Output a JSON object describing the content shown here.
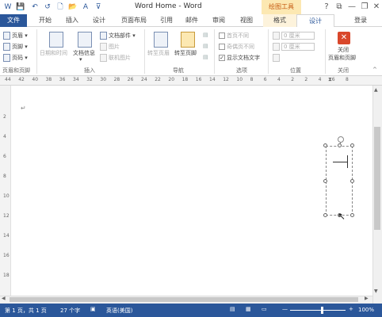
{
  "window": {
    "title": "Word Home - Word",
    "context_tab_group": "绘图工具",
    "help": "?",
    "minimize": "—",
    "restore": "❐",
    "close": "✕"
  },
  "quick_access": {
    "save": "💾",
    "undo": "↶",
    "redo": "↺",
    "new": "🗋",
    "open": "📂",
    "format_painter": "A",
    "more": "⊽"
  },
  "tabs": {
    "file": "文件",
    "home": "开始",
    "insert": "插入",
    "design": "设计",
    "layout": "页面布局",
    "references": "引用",
    "mailings": "邮件",
    "review": "审阅",
    "view": "视图",
    "format": "格式",
    "hf_design": "设计",
    "login": "登录"
  },
  "ribbon": {
    "hf_group": {
      "header": "页眉",
      "footer": "页脚",
      "page_number": "页码",
      "label": "页眉和页脚"
    },
    "insert_group": {
      "datetime": "日期和时间",
      "docinfo": "文档信息",
      "quickparts": "文档部件",
      "picture": "图片",
      "online_picture": "联机图片",
      "label": "插入"
    },
    "nav_group": {
      "goto_header": "转至页眉",
      "goto_footer": "转至页脚",
      "label": "导航"
    },
    "options_group": {
      "diff_first": "首页不同",
      "diff_oddeven": "奇偶页不同",
      "show_doc_text": "显示文档文字",
      "label": "选项"
    },
    "position_group": {
      "header_pos": "0 厘米",
      "footer_pos": "0 厘米",
      "label": "位置"
    },
    "close_group": {
      "close_line1": "关闭",
      "close_line2": "页眉和页脚",
      "label": "关闭"
    }
  },
  "ruler_ticks": [
    "44",
    "42",
    "40",
    "38",
    "36",
    "34",
    "32",
    "30",
    "28",
    "26",
    "24",
    "22",
    "20",
    "18",
    "16",
    "14",
    "12",
    "10",
    "8",
    "6",
    "4",
    "2",
    "2",
    "4",
    "6",
    "8"
  ],
  "vruler_ticks": [
    "2",
    "4",
    "6",
    "8",
    "10",
    "12",
    "14",
    "16",
    "18"
  ],
  "document": {
    "para_mark": "↵"
  },
  "status": {
    "page": "第 1 页，共 1 页",
    "words": "27 个字",
    "lang": "英语(美国)",
    "zoom": "100%",
    "zoom_minus": "—",
    "zoom_plus": "+",
    "zoom_level": 0.55
  }
}
